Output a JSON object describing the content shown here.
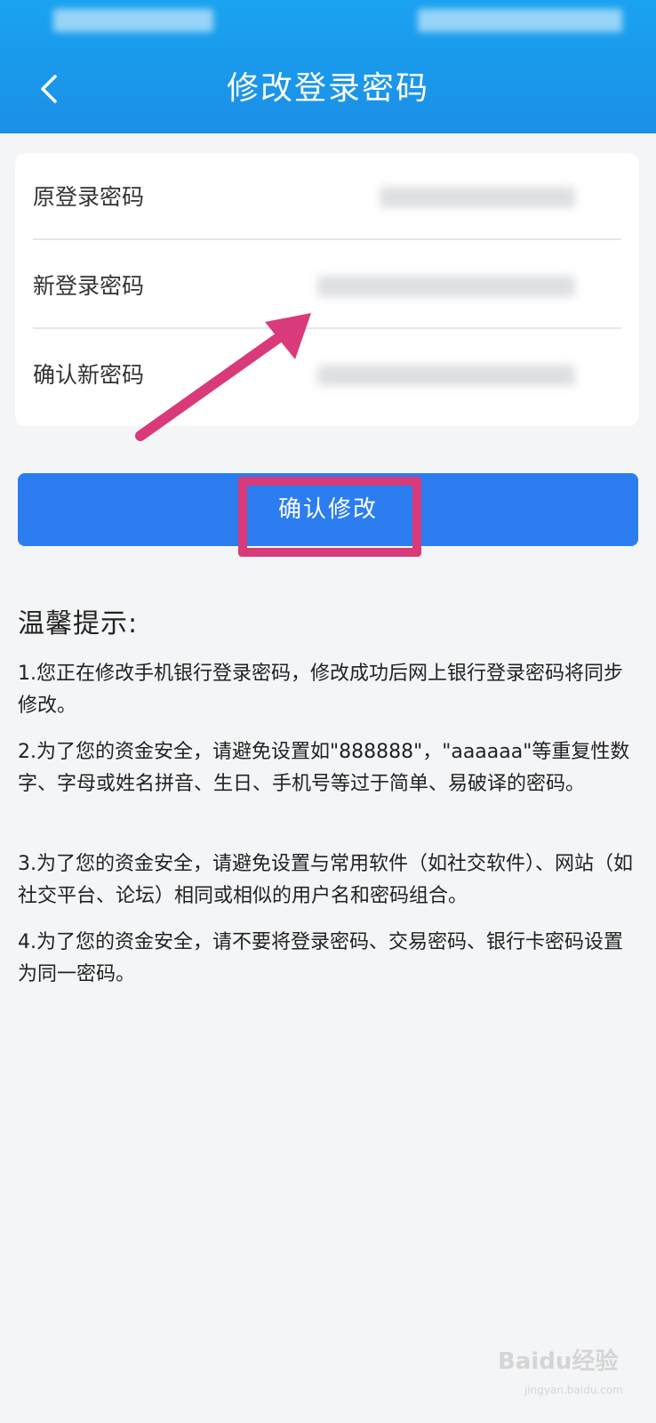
{
  "header": {
    "title": "修改登录密码"
  },
  "form": {
    "rows": [
      {
        "label": "原登录密码"
      },
      {
        "label": "新登录密码"
      },
      {
        "label": "确认新密码"
      }
    ]
  },
  "actions": {
    "confirm_label": "确认修改"
  },
  "tips": {
    "title": "温馨提示:",
    "items": [
      "1.您正在修改手机银行登录密码，修改成功后网上银行登录密码将同步修改。",
      "2.为了您的资金安全，请避免设置如\"888888\"，\"aaaaaa\"等重复性数字、字母或姓名拼音、生日、手机号等过于简单、易破译的密码。",
      "3.为了您的资金安全，请避免设置与常用软件（如社交软件）、网站（如社交平台、论坛）相同或相似的用户名和密码组合。",
      "4.为了您的资金安全，请不要将登录密码、交易密码、银行卡密码设置为同一密码。"
    ]
  },
  "watermark": {
    "brand": "Baidu经验",
    "url": "jingyan.baidu.com"
  },
  "colors": {
    "header": "#1b8fe6",
    "button": "#2b7df0",
    "highlight": "#d93a79"
  }
}
